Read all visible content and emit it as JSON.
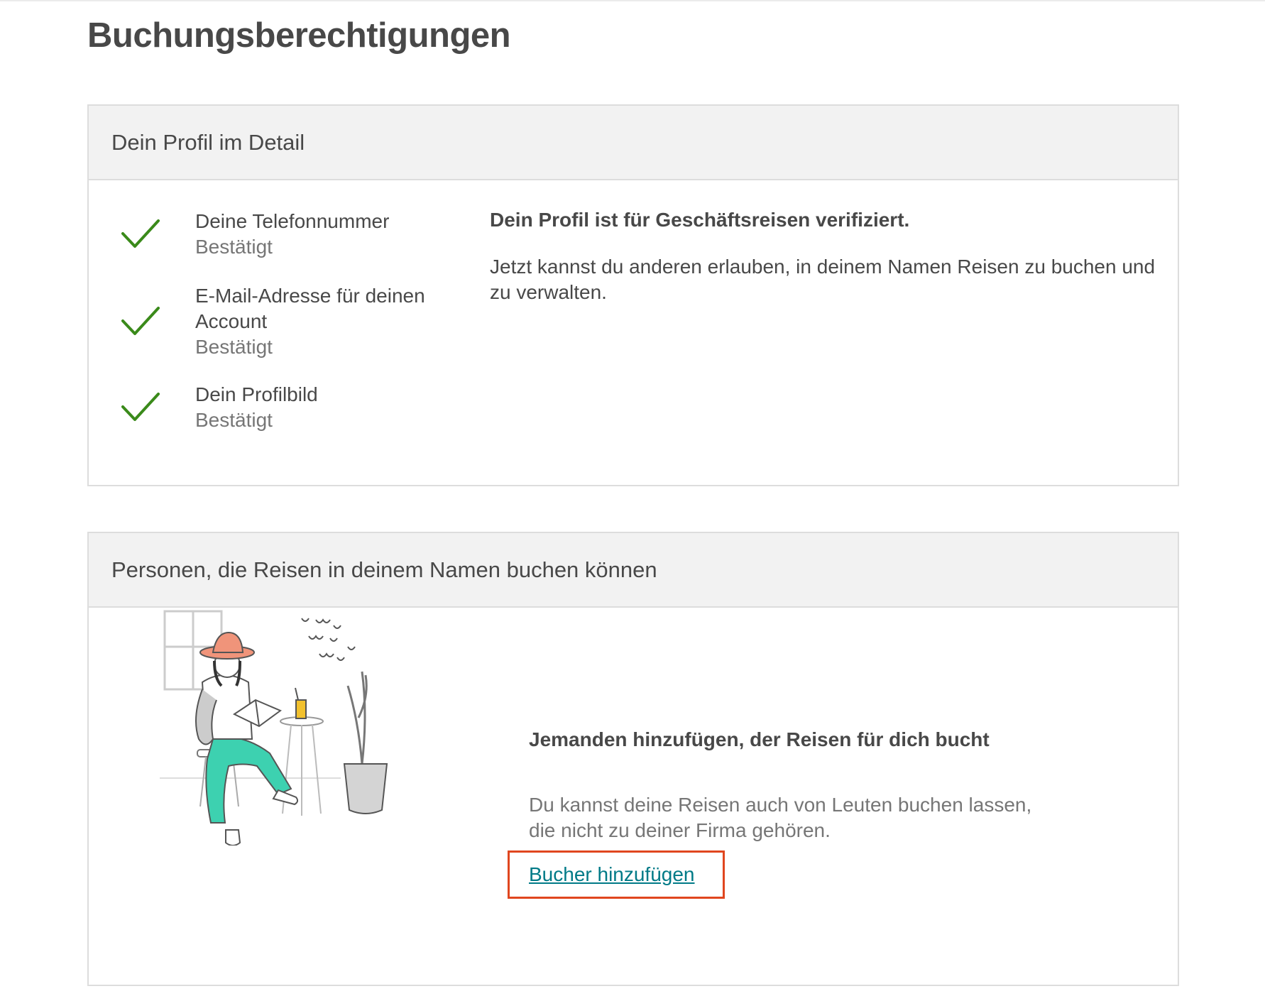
{
  "page": {
    "title": "Buchungsberechtigungen"
  },
  "profile_card": {
    "header": "Dein Profil im Detail",
    "items": [
      {
        "label": "Deine Telefonnummer",
        "status": "Bestätigt",
        "icon": "check-icon"
      },
      {
        "label": "E-Mail-Adresse für deinen Account",
        "status": "Bestätigt",
        "icon": "check-icon"
      },
      {
        "label": "Dein Profilbild",
        "status": "Bestätigt",
        "icon": "check-icon"
      }
    ],
    "status_title": "Dein Profil ist für Geschäftsreisen verifiziert.",
    "status_desc": "Jetzt kannst du anderen erlauben, in deinem Namen Reisen zu buchen und zu verwalten."
  },
  "bookers_card": {
    "header": "Personen, die Reisen in deinem Namen buchen können",
    "illustration": "person-reading-illustration",
    "title": "Jemanden hinzufügen, der Reisen für dich bucht",
    "desc": "Du kannst deine Reisen auch von Leuten buchen lassen, die nicht zu deiner Firma gehören.",
    "link_label": "Bucher hinzufügen"
  },
  "colors": {
    "check": "#3a8a1a",
    "link": "#007a87",
    "highlight": "#e0461f",
    "header_bg": "#f2f2f2",
    "text": "#484848",
    "muted": "#767676"
  }
}
